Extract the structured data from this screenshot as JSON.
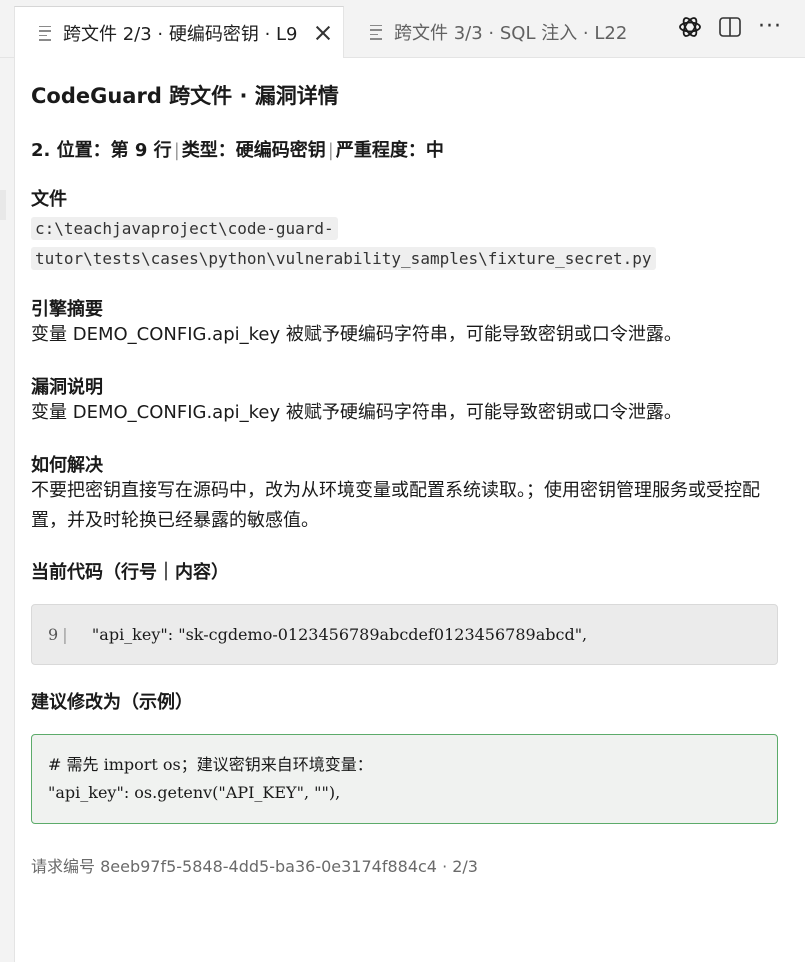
{
  "tabs": [
    {
      "label": "跨文件 2/3 · 硬编码密钥 · L9",
      "active": true
    },
    {
      "label": "跨文件 3/3 · SQL 注入 · L22",
      "active": false
    }
  ],
  "icons": {
    "tab_file": "file-lines-icon",
    "tab_close": "close-icon",
    "openai": "openai-icon",
    "split": "split-editor-icon",
    "more": "more-icon"
  },
  "actions": {
    "more_label": "···"
  },
  "title": "CodeGuard 跨文件 · 漏洞详情",
  "meta": {
    "index_location": "2. 位置：第 9 行",
    "type": "类型：硬编码密钥",
    "severity": "严重程度：中",
    "sep": "|"
  },
  "file": {
    "heading": "文件",
    "path_line1": "c:\\teachjavaproject\\code-guard-",
    "path_line2": "tutor\\tests\\cases\\python\\vulnerability_samples\\fixture_secret.py"
  },
  "engine_summary": {
    "heading": "引擎摘要",
    "text": "变量 DEMO_CONFIG.api_key 被赋予硬编码字符串，可能导致密钥或口令泄露。"
  },
  "description": {
    "heading": "漏洞说明",
    "text": "变量 DEMO_CONFIG.api_key 被赋予硬编码字符串，可能导致密钥或口令泄露。"
  },
  "fix": {
    "heading": "如何解决",
    "text": "不要把密钥直接写在源码中，改为从环境变量或配置系统读取。；使用密钥管理服务或受控配置，并及时轮换已经暴露的敏感值。"
  },
  "current_code": {
    "heading": "当前代码（行号｜内容）",
    "line_no": "9",
    "bar": "|",
    "content": "    \"api_key\": \"sk-cgdemo-0123456789abcdef0123456789abcd\","
  },
  "suggested": {
    "heading": "建议修改为（示例）",
    "code": "# 需先 import os；建议密钥来自环境变量：\n\"api_key\": os.getenv(\"API_KEY\", \"\"),"
  },
  "request": {
    "text": "请求编号 8eeb97f5-5848-4dd5-ba36-0e3174f884c4 · 2/3"
  },
  "colors": {
    "suggest_border": "#5cab6a",
    "code_bg": "#ebebeb"
  }
}
